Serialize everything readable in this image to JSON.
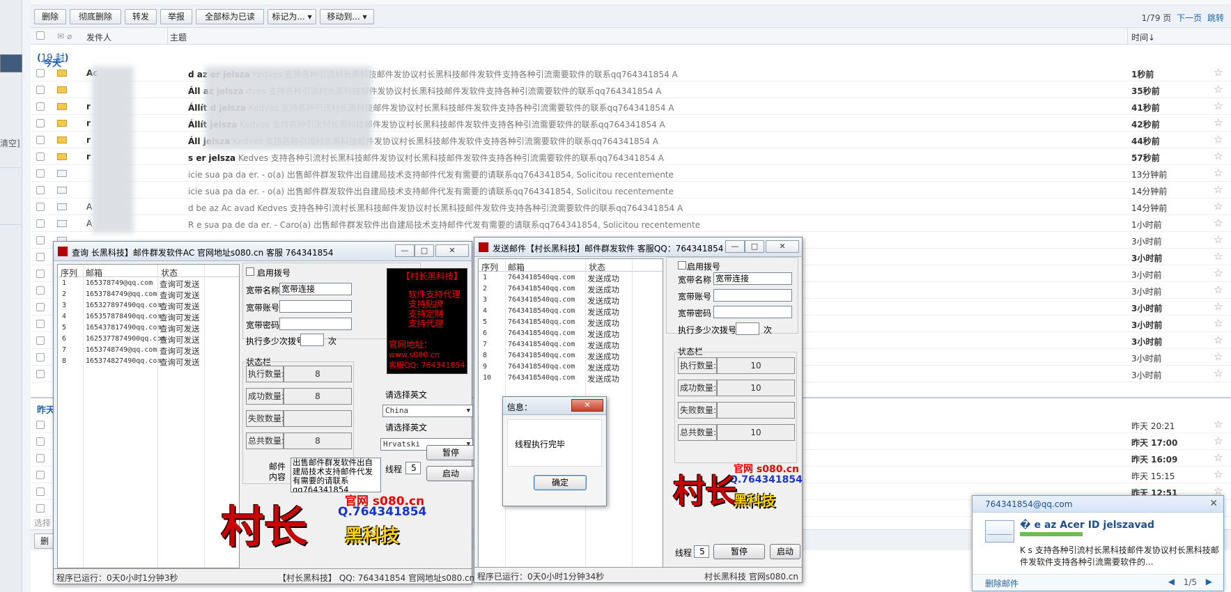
{
  "left": {
    "clear_label": "清空]"
  },
  "toolbar": {
    "buttons": [
      "删除",
      "彻底删除",
      "转发",
      "举报",
      "全部标为已读",
      "标记为...",
      "移动到..."
    ],
    "pager": {
      "page": "1/79 页",
      "next": "下一页",
      "jump": "跳转"
    }
  },
  "header": {
    "sender": "发件人",
    "subject": "主题",
    "time": "时间↓"
  },
  "groups": {
    "today_label": "今天",
    "today_count": "19 封",
    "yesterday_label": "昨天"
  },
  "emails": [
    {
      "sender": "Ac",
      "subject": "kedves 支持各种引流村长黑科技邮件发协议村长黑科技邮件发软件支持各种引流需要软件的联系qq764341854 A",
      "bold_subj": "d   az   er   jelsza",
      "time": "1秒前",
      "unread": true
    },
    {
      "sender": "",
      "subject": "dves 支持各种引流村长黑科技邮件发协议村长黑科技邮件发软件支持各种引流需要软件的联系qq764341854 A",
      "bold_subj": "Áll   az   jelsza",
      "time": "35秒前",
      "unread": true
    },
    {
      "sender": "r",
      "subject": "Kedves 支持各种引流村长黑科技邮件发协议村长黑科技邮件发软件支持各种引流需要软件的联系qq764341854 A",
      "bold_subj": "Állít   d   jelsza",
      "time": "41秒前",
      "unread": true
    },
    {
      "sender": "r",
      "subject": "Kedves 支持各种引流村长黑科技邮件发协议村长黑科技邮件发软件支持各种引流需要软件的联系qq764341854 A",
      "bold_subj": "Állít   jelsza",
      "time": "42秒前",
      "unread": true
    },
    {
      "sender": "r",
      "subject": "Kedves 支持各种引流村长黑科技邮件发协议村长黑科技邮件发软件支持各种引流需要软件的联系qq764341854 A",
      "bold_subj": "Áll   jelsza",
      "time": "44秒前",
      "unread": true
    },
    {
      "sender": "r",
      "subject": "Kedves 支持各种引流村长黑科技邮件发协议村长黑科技邮件发软件支持各种引流需要软件的联系qq764341854 A",
      "bold_subj": "s   er   jelsza",
      "time": "57秒前",
      "unread": true
    },
    {
      "sender": "",
      "subject": "icie sua pa   da   er. -   o(a) 出售邮件群发软件出自建局技术支持邮件代发有需要的请联系qq764341854, Solicitou recentemente",
      "bold_subj": "",
      "time": "13分钟前",
      "unread": false
    },
    {
      "sender": "",
      "subject": "icie sua pa   da   er. -   o(a) 出售邮件群发软件出自建局技术支持邮件代发有需要的请联系qq764341854, Solicitou recentemente",
      "bold_subj": "",
      "time": "14分钟前",
      "unread": false
    },
    {
      "sender": "A",
      "subject": "d be az Ac   avad   Kedves 支持各种引流村长黑科技邮件发协议村长黑科技邮件发软件支持各种引流需要软件的联系qq764341854 A",
      "bold_subj": "",
      "time": "14分钟前",
      "unread": false
    },
    {
      "sender": "A",
      "subject": "R   e sua pa   de da   er. -  Caro(a) 出售邮件群发软件出自建局技术支持邮件代发有需要的请联系qq764341854, Solicitou recentemente",
      "bold_subj": "",
      "time": "1小时前",
      "unread": false
    },
    {
      "sender": "",
      "subject": "",
      "bold_subj": "",
      "time": "3小时前",
      "unread": false
    },
    {
      "sender": "",
      "subject": "",
      "bold_subj": "",
      "time": "3小时前",
      "unread": true
    },
    {
      "sender": "",
      "subject": "",
      "bold_subj": "",
      "time": "3小时前",
      "unread": false
    },
    {
      "sender": "",
      "subject": "",
      "bold_subj": "",
      "time": "3小时前",
      "unread": false
    },
    {
      "sender": "",
      "subject": "",
      "bold_subj": "",
      "time": "3小时前",
      "unread": true
    },
    {
      "sender": "",
      "subject": "",
      "bold_subj": "",
      "time": "3小时前",
      "unread": true
    },
    {
      "sender": "",
      "subject": "",
      "bold_subj": "",
      "time": "3小时前",
      "unread": true
    },
    {
      "sender": "",
      "subject": "",
      "bold_subj": "",
      "time": "3小时前",
      "unread": false
    },
    {
      "sender": "",
      "subject": "",
      "bold_subj": "",
      "time": "3小时前",
      "unread": false
    }
  ],
  "yesterday_emails": [
    {
      "time": "昨天 20:21",
      "unread": false
    },
    {
      "time": "昨天 17:00",
      "unread": true
    },
    {
      "time": "昨天 16:09",
      "unread": true
    },
    {
      "time": "昨天 15:15",
      "unread": false
    },
    {
      "time": "昨天 12:51",
      "unread": true
    },
    {
      "time": "",
      "unread": false
    }
  ],
  "bottom": {
    "select_label": "选择",
    "delete_label": "删"
  },
  "query_window": {
    "title": "查询   长黑科技】邮件群发软件AC   官网地址s080.cn   客服   764341854",
    "controls": [
      "—",
      "□",
      "✕"
    ],
    "cols": [
      "序列",
      "邮箱",
      "状态"
    ],
    "rows": [
      [
        "1",
        "165378749@qq.com",
        "查询可发送"
      ],
      [
        "2",
        "1653784749@qq.com",
        "查询可发送"
      ],
      [
        "3",
        "165327897490qq.com",
        "查询可发送"
      ],
      [
        "4",
        "165357878490qq.com",
        "查询可发送"
      ],
      [
        "5",
        "165437817490qq.com",
        "查询可发送"
      ],
      [
        "6",
        "1625377874900qq.com",
        "查询可发送"
      ],
      [
        "7",
        "1653748749@qq.com",
        "查询可发送"
      ],
      [
        "8",
        "165374827490qq.com",
        "查询可发送"
      ]
    ],
    "dial_label": "启用拨号",
    "bb_name_label": "宽带名称",
    "bb_name_value": "宽带连接",
    "bb_account_label": "宽带账号",
    "bb_password_label": "宽带密码",
    "dial_times_label": "执行多少次拨号",
    "dial_times_unit": "次",
    "status_group": "状态栏",
    "exec_label": "执行数量:",
    "exec_value": "8",
    "success_label": "成功数量:",
    "success_value": "8",
    "fail_label": "失败数量:",
    "fail_value": "",
    "total_label": "总共数量:",
    "total_value": "8",
    "promo_lines": [
      "【村长黑科技】",
      "软件支持代理",
      "支持贴牌",
      "支持定制",
      "支持代理"
    ],
    "site_label": "官网地址：",
    "site_url": "www.s080.cn",
    "support_qq": "客服QQ: 764341854",
    "english_label1": "请选择英文",
    "english_value1": "China",
    "english_label2": "请选择英文",
    "english_value2": "Hrvatski",
    "mail_content_label": "邮件内容",
    "mail_content": "出售邮件群发软件出自建局技术支持邮件代发有需要的请联系qq764341854",
    "thread_label": "线程",
    "thread_value": "5",
    "pause_label": "暂停",
    "start_label": "启动",
    "logo_site": "官网 s080.cn",
    "logo_qq": "Q.764341854",
    "logo_big": "村长",
    "logo_sub": "黑科技",
    "status_runtime": "程序已运行：0天0小时1分钟3秒",
    "status_brand": "【村长黑科技】 QQ: 764341854   官网地址s080.cn  AC"
  },
  "send_window": {
    "title": "发送邮件【村长黑科技】邮件群发软件 客服QQ：764341854",
    "controls": [
      "—",
      "□",
      "✕"
    ],
    "cols": [
      "序列",
      "邮箱",
      "状态"
    ],
    "rows": [
      [
        "1",
        "7643418540qq.com",
        "发送成功"
      ],
      [
        "2",
        "7643418540qq.com",
        "发送成功"
      ],
      [
        "3",
        "7643418540qq.com",
        "发送成功"
      ],
      [
        "4",
        "7643418540qq.com",
        "发送成功"
      ],
      [
        "5",
        "7643418540qq.com",
        "发送成功"
      ],
      [
        "6",
        "7643418540qq.com",
        "发送成功"
      ],
      [
        "7",
        "7643418540qq.com",
        "发送成功"
      ],
      [
        "8",
        "7643418540qq.com",
        "发送成功"
      ],
      [
        "9",
        "7643418540qq.com",
        "发送成功"
      ],
      [
        "10",
        "7643418540qq.com",
        "发送成功"
      ]
    ],
    "dial_label": "启用拨号",
    "bb_name_label": "宽带名称",
    "bb_name_value": "宽带连接",
    "bb_account_label": "宽带账号",
    "bb_password_label": "宽带密码",
    "dial_times_label": "执行多少次拨号",
    "dial_times_unit": "次",
    "status_group": "状态栏",
    "exec_label": "执行数量:",
    "exec_value": "10",
    "success_label": "成功数量:",
    "success_value": "10",
    "fail_label": "失败数量:",
    "fail_value": "",
    "total_label": "总共数量:",
    "total_value": "10",
    "logo_site": "官网 s080.cn",
    "logo_qq": "Q.764341854",
    "logo_big": "村长",
    "logo_sub": "黑科技",
    "thread_label": "线程",
    "thread_value": "5",
    "pause_label": "暂停",
    "start_label": "启动",
    "status_runtime": "程序已运行：0天0小时1分钟34秒",
    "status_brand": "村长黑科技   官网s080.cn"
  },
  "info_dialog": {
    "title": "信息：",
    "close": "✕",
    "message": "线程执行完毕",
    "ok_label": "确定"
  },
  "notification": {
    "email": "764341854@qq.com",
    "close": "✕",
    "subject": "�         e az Acer ID jelszavad",
    "preview": "K      s 支持各种引流村长黑科技邮件发协议村长黑科技邮件发软件支持各种引流需要软件的...",
    "delete_label": "删除邮件",
    "pager": "1/5"
  }
}
